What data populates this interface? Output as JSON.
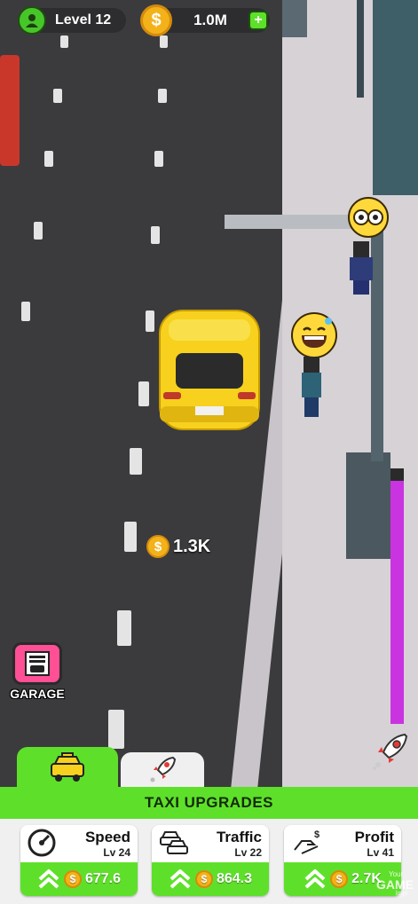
{
  "hud": {
    "level_label": "Level 12",
    "coins_label": "1.0M",
    "add_symbol": "+",
    "coin_symbol": "$"
  },
  "world": {
    "floating_reward": "1.3K"
  },
  "garage": {
    "label": "GARAGE"
  },
  "tabs": [
    {
      "name": "taxi",
      "icon": "taxi-icon",
      "active": true
    },
    {
      "name": "boost",
      "icon": "rocket-icon",
      "active": false
    }
  ],
  "upgrades": {
    "header": "TAXI UPGRADES",
    "items": [
      {
        "title": "Speed",
        "level": "Lv 24",
        "cost": "677.6",
        "icon": "speedometer-icon"
      },
      {
        "title": "Traffic",
        "level": "Lv 22",
        "cost": "864.3",
        "icon": "traffic-cars-icon"
      },
      {
        "title": "Profit",
        "level": "Lv 41",
        "cost": "2.7K",
        "icon": "money-hand-icon"
      }
    ]
  },
  "watermark": {
    "line1": "Your",
    "line2": "GAME",
    "line3": "logo"
  },
  "colors": {
    "accent_green": "#5ee02a",
    "boost_bar": "#c934e0",
    "taxi_yellow": "#f7d11d",
    "coin_gold": "#f3b21a"
  },
  "boost_meter": {
    "fill_fraction": 0.95
  }
}
